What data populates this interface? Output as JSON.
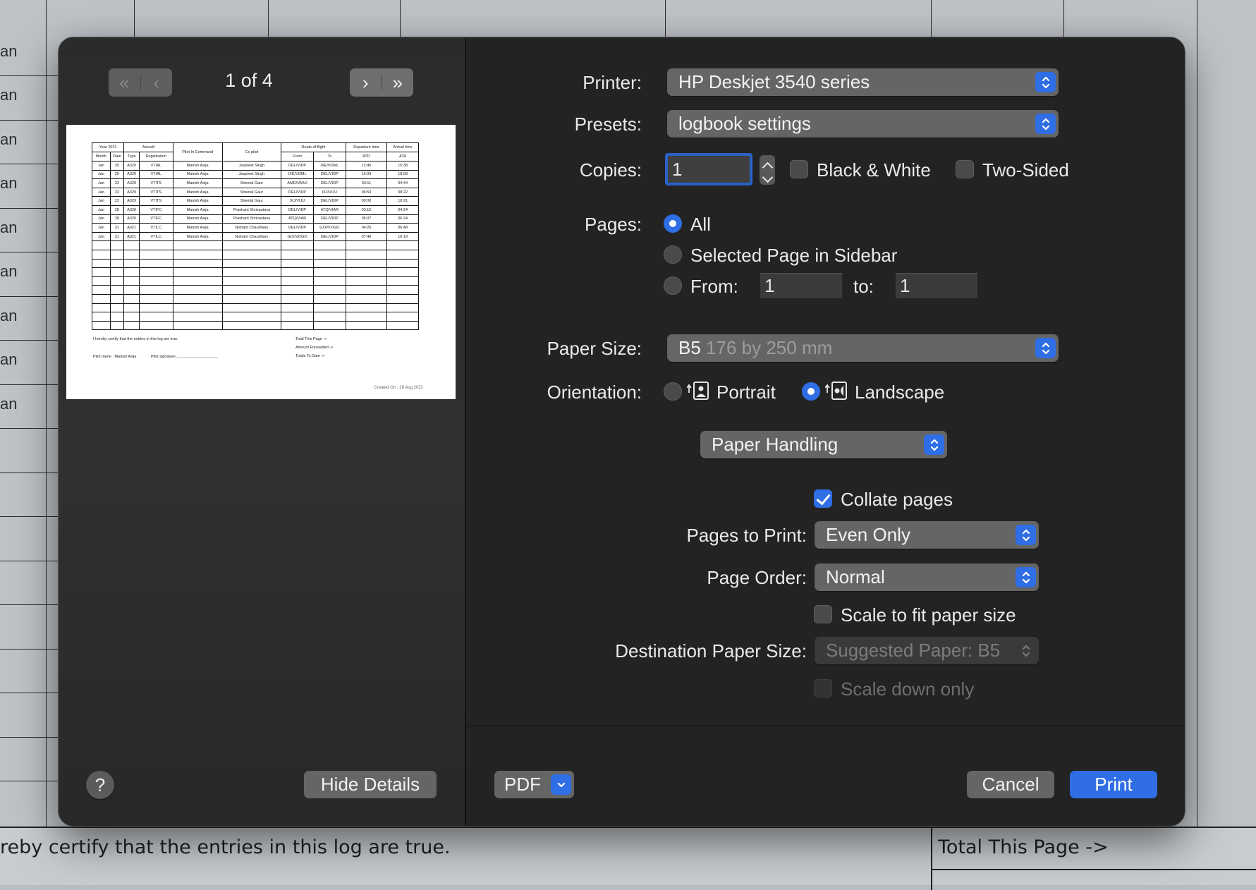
{
  "background": {
    "row_labels": [
      "an",
      "an",
      "an",
      "an",
      "an",
      "an",
      "an",
      "an",
      "an"
    ],
    "certify_text": "reby certify that the entries in this log are true.",
    "total_text": "Total This Page ->"
  },
  "sidebar": {
    "page_indicator": "1 of 4",
    "hide_details_label": "Hide Details",
    "help_label": "?",
    "preview": {
      "header_groups": [
        "Year 2021",
        "Aircraft",
        "Pilot In Command",
        "Co pilot",
        "Route of flight",
        "Departure time",
        "Arrival time"
      ],
      "columns": [
        "Month",
        "Date",
        "Type",
        "Registration",
        "From",
        "To",
        "ATD",
        "ATA"
      ],
      "rows": [
        [
          "Jan",
          "20",
          "A320",
          "VTIAL",
          "Manish Asija",
          "Jaspreet Singh",
          "DEL/VIDP",
          "IXE/VOML",
          "12:45",
          "15:38"
        ],
        [
          "Jan",
          "20",
          "A320",
          "VTIAL",
          "Manish Asija",
          "Jaspreet Singh",
          "IXE/VOML",
          "DEL/VIDP",
          "16:09",
          "18:58"
        ],
        [
          "Jan",
          "22",
          "A320",
          "VTITS",
          "Manish Asija",
          "Sheetal Gaur",
          "AMD/VAAH",
          "DEL/VIDP",
          "03:11",
          "04:44"
        ],
        [
          "Jan",
          "22",
          "A320",
          "VTITS",
          "Manish Asija",
          "Sheetal Gaur",
          "DEL/VIDP",
          "IXJ/VIJU",
          "06:53",
          "08:22"
        ],
        [
          "Jan",
          "22",
          "A320",
          "VTITS",
          "Manish Asija",
          "Sheetal Gaur",
          "IXJ/VIJU",
          "DEL/VIDP",
          "09:00",
          "10:21"
        ],
        [
          "Jan",
          "28",
          "A320",
          "VTIFC",
          "Manish Asija",
          "Prashant Shrivastava",
          "DEL/VIDP",
          "ATQ/VIAR",
          "03:15",
          "04:24"
        ],
        [
          "Jan",
          "28",
          "A320",
          "VTIFC",
          "Manish Asija",
          "Prashant Shrivastava",
          "ATQ/VIAR",
          "DEL/VIDP",
          "05:07",
          "06:24"
        ],
        [
          "Jan",
          "31",
          "A321",
          "VTILC",
          "Manish Asija",
          "Nishant Chaudhary",
          "DEL/VIDP",
          "GOI/VOGO",
          "04:26",
          "06:48"
        ],
        [
          "Jan",
          "31",
          "A321",
          "VTILC",
          "Manish Asija",
          "Nishant Chaudhary",
          "GOI/VOGO",
          "DEL/VIDP",
          "07:46",
          "10:19"
        ]
      ],
      "certify": "I hereby certify that the entries in this log are true.",
      "pilot_name": "Pilot name : Manish Asija",
      "pilot_signature": "Pilot signature ___________________",
      "totals": [
        "Total This Page ->",
        "Amount Forwarded ->",
        "Totals To Date ->"
      ],
      "created_on": "Created On : 28 Aug 2022"
    }
  },
  "settings": {
    "printer": {
      "label": "Printer:",
      "value": "HP Deskjet 3540 series"
    },
    "presets": {
      "label": "Presets:",
      "value": "logbook settings"
    },
    "copies": {
      "label": "Copies:",
      "value": "1",
      "black_white_label": "Black & White",
      "black_white": false,
      "two_sided_label": "Two-Sided",
      "two_sided": false
    },
    "pages": {
      "label": "Pages:",
      "all_label": "All",
      "selected_label": "Selected Page in Sidebar",
      "from_label": "From:",
      "from_value": "1",
      "to_label": "to:",
      "to_value": "1",
      "selected": "All"
    },
    "paper_size": {
      "label": "Paper Size:",
      "value": "B5",
      "detail": "176 by 250 mm"
    },
    "orientation": {
      "label": "Orientation:",
      "portrait_label": "Portrait",
      "landscape_label": "Landscape",
      "selected": "Landscape"
    },
    "section_popup": "Paper Handling",
    "collate": {
      "label": "Collate pages",
      "checked": true
    },
    "pages_to_print": {
      "label": "Pages to Print:",
      "value": "Even Only"
    },
    "page_order": {
      "label": "Page Order:",
      "value": "Normal"
    },
    "scale_fit": {
      "label": "Scale to fit paper size",
      "checked": false
    },
    "destination_paper": {
      "label": "Destination Paper Size:",
      "value": "Suggested Paper: B5"
    },
    "scale_down": {
      "label": "Scale down only",
      "checked": false,
      "enabled": false
    }
  },
  "footer": {
    "pdf_label": "PDF",
    "cancel_label": "Cancel",
    "print_label": "Print"
  },
  "colors": {
    "accent": "#2f6ee5",
    "dialog_bg": "#232323",
    "button_bg": "#656565"
  }
}
